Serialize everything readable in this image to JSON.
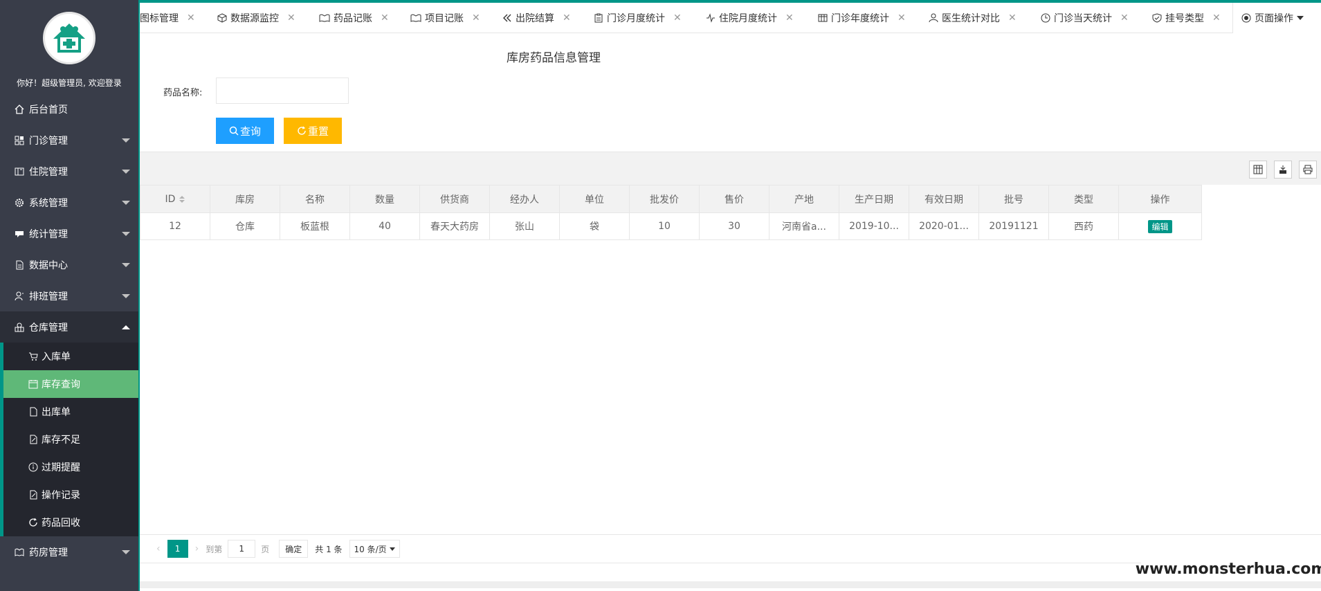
{
  "sidebar": {
    "welcome": "你好！超级管理员, 欢迎登录",
    "items": [
      {
        "label": "后台首页",
        "icon": "home-icon",
        "expandable": false
      },
      {
        "label": "门诊管理",
        "icon": "apps-icon",
        "expandable": true
      },
      {
        "label": "住院管理",
        "icon": "book-icon",
        "expandable": true
      },
      {
        "label": "系统管理",
        "icon": "gear-icon",
        "expandable": true
      },
      {
        "label": "统计管理",
        "icon": "chat-icon",
        "expandable": true
      },
      {
        "label": "数据中心",
        "icon": "file-icon",
        "expandable": true
      },
      {
        "label": "排班管理",
        "icon": "user-group-icon",
        "expandable": true
      },
      {
        "label": "仓库管理",
        "icon": "warehouse-icon",
        "expandable": true,
        "open": true
      },
      {
        "label": "药房管理",
        "icon": "pharmacy-icon",
        "expandable": true
      }
    ],
    "warehouse_sub": [
      {
        "label": "入库单",
        "icon": "cart-icon"
      },
      {
        "label": "库存查询",
        "icon": "calendar-icon",
        "active": true
      },
      {
        "label": "出库单",
        "icon": "document-icon"
      },
      {
        "label": "库存不足",
        "icon": "edit-doc-icon"
      },
      {
        "label": "过期提醒",
        "icon": "info-icon"
      },
      {
        "label": "操作记录",
        "icon": "record-icon"
      },
      {
        "label": "药品回收",
        "icon": "refresh-icon"
      }
    ]
  },
  "tabs": [
    {
      "label": "图标管理",
      "icon": ""
    },
    {
      "label": "数据源监控",
      "icon": "cube-icon"
    },
    {
      "label": "药品记账",
      "icon": "read-icon"
    },
    {
      "label": "项目记账",
      "icon": "read-icon"
    },
    {
      "label": "出院结算",
      "icon": "double-left-icon"
    },
    {
      "label": "门诊月度统计",
      "icon": "clipboard-icon"
    },
    {
      "label": "住院月度统计",
      "icon": "pulse-icon"
    },
    {
      "label": "门诊年度统计",
      "icon": "table-icon"
    },
    {
      "label": "医生统计对比",
      "icon": "user-icon"
    },
    {
      "label": "门诊当天统计",
      "icon": "clock-icon"
    },
    {
      "label": "挂号类型",
      "icon": "shield-icon"
    }
  ],
  "page_ops": {
    "label": "页面操作"
  },
  "main": {
    "title": "库房药品信息管理",
    "search_label": "药品名称:",
    "search_value": "",
    "search_button": "查询",
    "reset_button": "重置"
  },
  "table": {
    "columns": [
      "ID",
      "库房",
      "名称",
      "数量",
      "供货商",
      "经办人",
      "单位",
      "批发价",
      "售价",
      "产地",
      "生产日期",
      "有效日期",
      "批号",
      "类型",
      "操作"
    ],
    "rows": [
      [
        "12",
        "仓库",
        "板蓝根",
        "40",
        "春天大药房",
        "张山",
        "袋",
        "10",
        "30",
        "河南省a...",
        "2019-10...",
        "2020-01...",
        "20191121",
        "西药"
      ]
    ],
    "edit_label": "编辑"
  },
  "pager": {
    "current": "1",
    "goto_prefix": "到第",
    "goto_value": "1",
    "goto_suffix": "页",
    "ok": "确定",
    "total": "共 1 条",
    "page_size": "10 条/页"
  },
  "watermark": "www.monsterhua.com",
  "colors": {
    "sidebar": "#393d49",
    "accent": "#009688",
    "active_sub": "#5fb878",
    "search_btn": "#1e9fff",
    "reset_btn": "#ffb800"
  }
}
